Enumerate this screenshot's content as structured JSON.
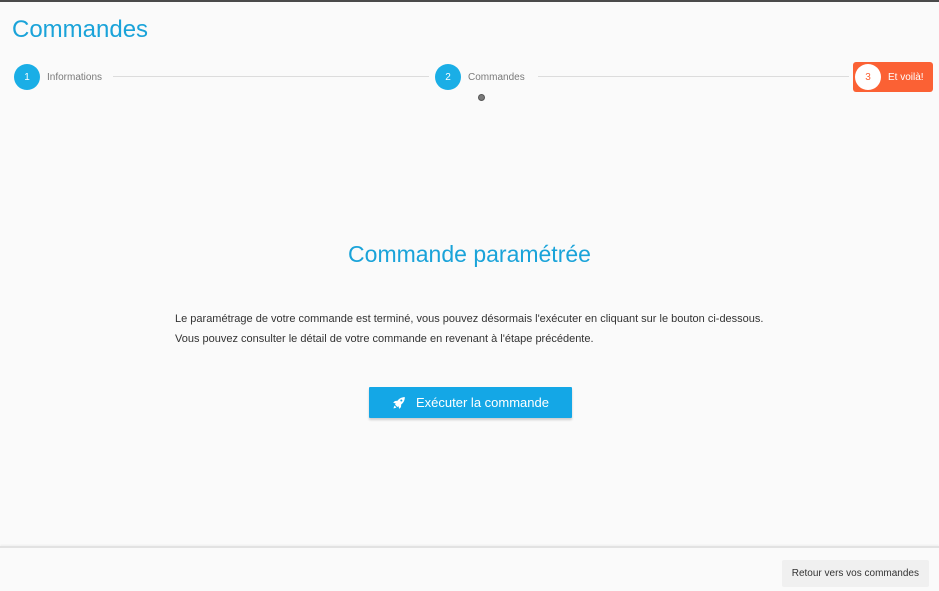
{
  "header": {
    "title": "Commandes"
  },
  "stepper": {
    "steps": [
      {
        "number": "1",
        "label": "Informations"
      },
      {
        "number": "2",
        "label": "Commandes"
      },
      {
        "number": "3",
        "label": "Et voilà!"
      }
    ],
    "active_step": 3
  },
  "main": {
    "heading": "Commande paramétrée",
    "description_line1": "Le paramétrage de votre commande est terminé, vous pouvez désormais l'exécuter en cliquant sur le bouton ci-dessous.",
    "description_line2": "Vous pouvez consulter le détail de votre commande en revenant à l'étape précédente.",
    "execute_label": "Exécuter la commande",
    "execute_icon": "rocket-icon"
  },
  "footer": {
    "back_label": "Retour vers vos commandes"
  },
  "colors": {
    "accent": "#1aa3d9",
    "step": "#1aaee6",
    "active_step": "#fb6134",
    "button": "#14a7e6"
  }
}
